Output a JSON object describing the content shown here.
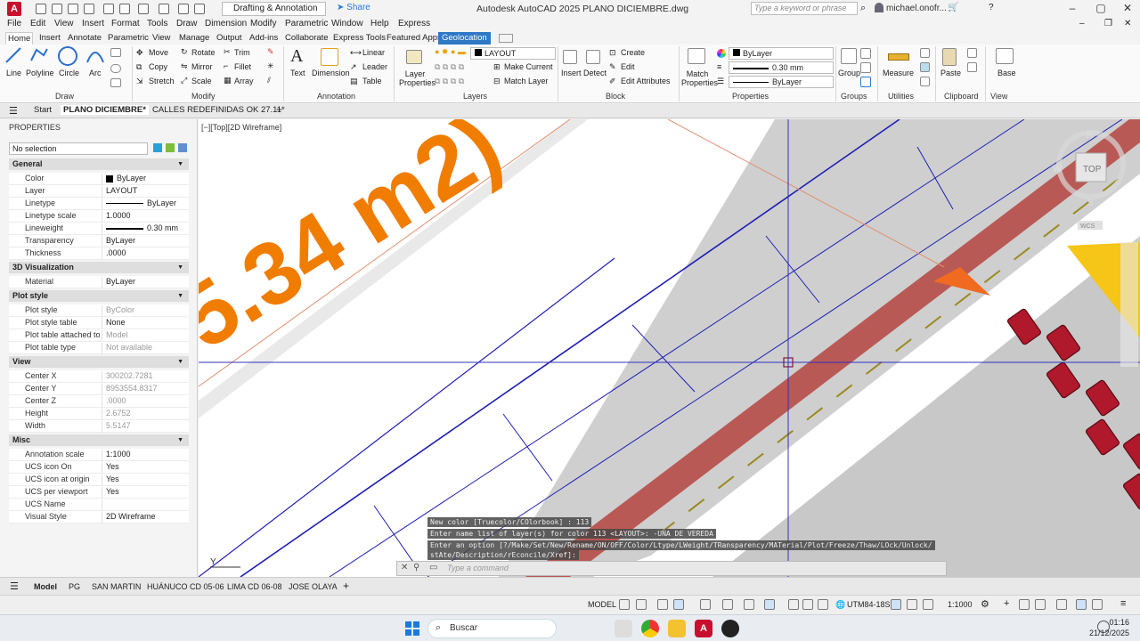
{
  "titlebar": {
    "workspace": "Drafting & Annotation",
    "share": "Share",
    "title": "Autodesk AutoCAD 2025   PLANO DICIEMBRE.dwg",
    "search_placeholder": "Type a keyword or phrase",
    "user": "michael.onofr..."
  },
  "menu": [
    "File",
    "Edit",
    "View",
    "Insert",
    "Format",
    "Tools",
    "Draw",
    "Dimension",
    "Modify",
    "Parametric",
    "Window",
    "Help",
    "Express"
  ],
  "ribbon_tabs": [
    "Home",
    "Insert",
    "Annotate",
    "Parametric",
    "View",
    "Manage",
    "Output",
    "Add-ins",
    "Collaborate",
    "Express Tools",
    "Featured Apps",
    "Geolocation"
  ],
  "ribbon": {
    "draw": {
      "line": "Line",
      "polyline": "Polyline",
      "circle": "Circle",
      "arc": "Arc",
      "panel": "Draw"
    },
    "modify": {
      "move": "Move",
      "rotate": "Rotate",
      "trim": "Trim",
      "copy": "Copy",
      "mirror": "Mirror",
      "fillet": "Fillet",
      "stretch": "Stretch",
      "scale": "Scale",
      "array": "Array",
      "panel": "Modify"
    },
    "annotation": {
      "text": "Text",
      "dimension": "Dimension",
      "linear": "Linear",
      "leader": "Leader",
      "table": "Table",
      "panel": "Annotation"
    },
    "layers": {
      "layer_properties": "Layer Properties",
      "current_layer": "LAYOUT",
      "make_current": "Make Current",
      "match_layer": "Match Layer",
      "panel": "Layers"
    },
    "block": {
      "insert": "Insert",
      "detect": "Detect",
      "create": "Create",
      "edit": "Edit",
      "edit_attributes": "Edit Attributes",
      "panel": "Block"
    },
    "properties": {
      "match": "Match Properties",
      "color": "ByLayer",
      "lineweight": "0.30 mm",
      "linetype": "ByLayer",
      "panel": "Properties"
    },
    "groups": {
      "group": "Group",
      "panel": "Groups"
    },
    "utilities": {
      "measure": "Measure",
      "panel": "Utilities"
    },
    "clipboard": {
      "paste": "Paste",
      "panel": "Clipboard"
    },
    "view": {
      "base": "Base",
      "panel": "View"
    }
  },
  "file_tabs": [
    "Start",
    "PLANO DICIEMBRE*",
    "CALLES REDEFINIDAS OK 27.11*"
  ],
  "properties_palette": {
    "title": "PROPERTIES",
    "selection": "No selection",
    "sections": [
      {
        "name": "General",
        "rows": [
          [
            "Color",
            "ByLayer"
          ],
          [
            "Layer",
            "LAYOUT"
          ],
          [
            "Linetype",
            "ByLayer"
          ],
          [
            "Linetype scale",
            "1.0000"
          ],
          [
            "Lineweight",
            "0.30 mm"
          ],
          [
            "Transparency",
            "ByLayer"
          ],
          [
            "Thickness",
            ".0000"
          ]
        ]
      },
      {
        "name": "3D Visualization",
        "rows": [
          [
            "Material",
            "ByLayer"
          ]
        ]
      },
      {
        "name": "Plot style",
        "rows": [
          [
            "Plot style",
            "ByColor"
          ],
          [
            "Plot style table",
            "None"
          ],
          [
            "Plot table attached to",
            "Model"
          ],
          [
            "Plot table type",
            "Not available"
          ]
        ]
      },
      {
        "name": "View",
        "rows": [
          [
            "Center X",
            "300202.7281"
          ],
          [
            "Center Y",
            "8953554.8317"
          ],
          [
            "Center Z",
            ".0000"
          ],
          [
            "Height",
            "2.6752"
          ],
          [
            "Width",
            "5.5147"
          ]
        ]
      },
      {
        "name": "Misc",
        "rows": [
          [
            "Annotation scale",
            "1:1000"
          ],
          [
            "UCS icon On",
            "Yes"
          ],
          [
            "UCS icon at origin",
            "Yes"
          ],
          [
            "UCS per viewport",
            "Yes"
          ],
          [
            "UCS Name",
            ""
          ],
          [
            "Visual Style",
            "2D Wireframe"
          ]
        ]
      }
    ]
  },
  "viewport": {
    "label": "[−][Top][2D Wireframe]",
    "area_text": "5.34 m2)",
    "viewcube_top": "TOP",
    "compass_w": "W",
    "compass_n": "N",
    "compass_s": "S",
    "wcs": "WCS",
    "ucs_y": "Y"
  },
  "command": {
    "history": [
      "New color [Truecolor/COlorbook] : 113",
      "Enter name list of layer(s) for color 113 <LAYOUT>: -UÑA DE VEREDA",
      "Enter an option [?/Make/Set/New/Rename/ON/OFF/Color/Ltype/LWeight/TRansparency/MATerial/Plot/Freeze/Thaw/LOck/Unlock/",
      "stAte/Description/rEconcile/Xref]:"
    ],
    "placeholder": "Type a command"
  },
  "layout_tabs": [
    "Model",
    "PG",
    "SAN MARTIN",
    "HUÁNUCO CD 05-06",
    "LIMA CD 06-08",
    "JOSE OLAYA"
  ],
  "statusbar": {
    "model": "MODEL",
    "coord_system": "UTM84-18S",
    "scale": "1:1000"
  },
  "taskbar": {
    "search": "Buscar",
    "time": "01:16",
    "date": "21/12/2025"
  },
  "colors": {
    "accent": "#2e78c6",
    "road_red": "#b5443f",
    "orange_text": "#f07c00",
    "car_red": "#b0182c",
    "yellow": "#f5c518",
    "line_blue": "#1e1eb4"
  }
}
